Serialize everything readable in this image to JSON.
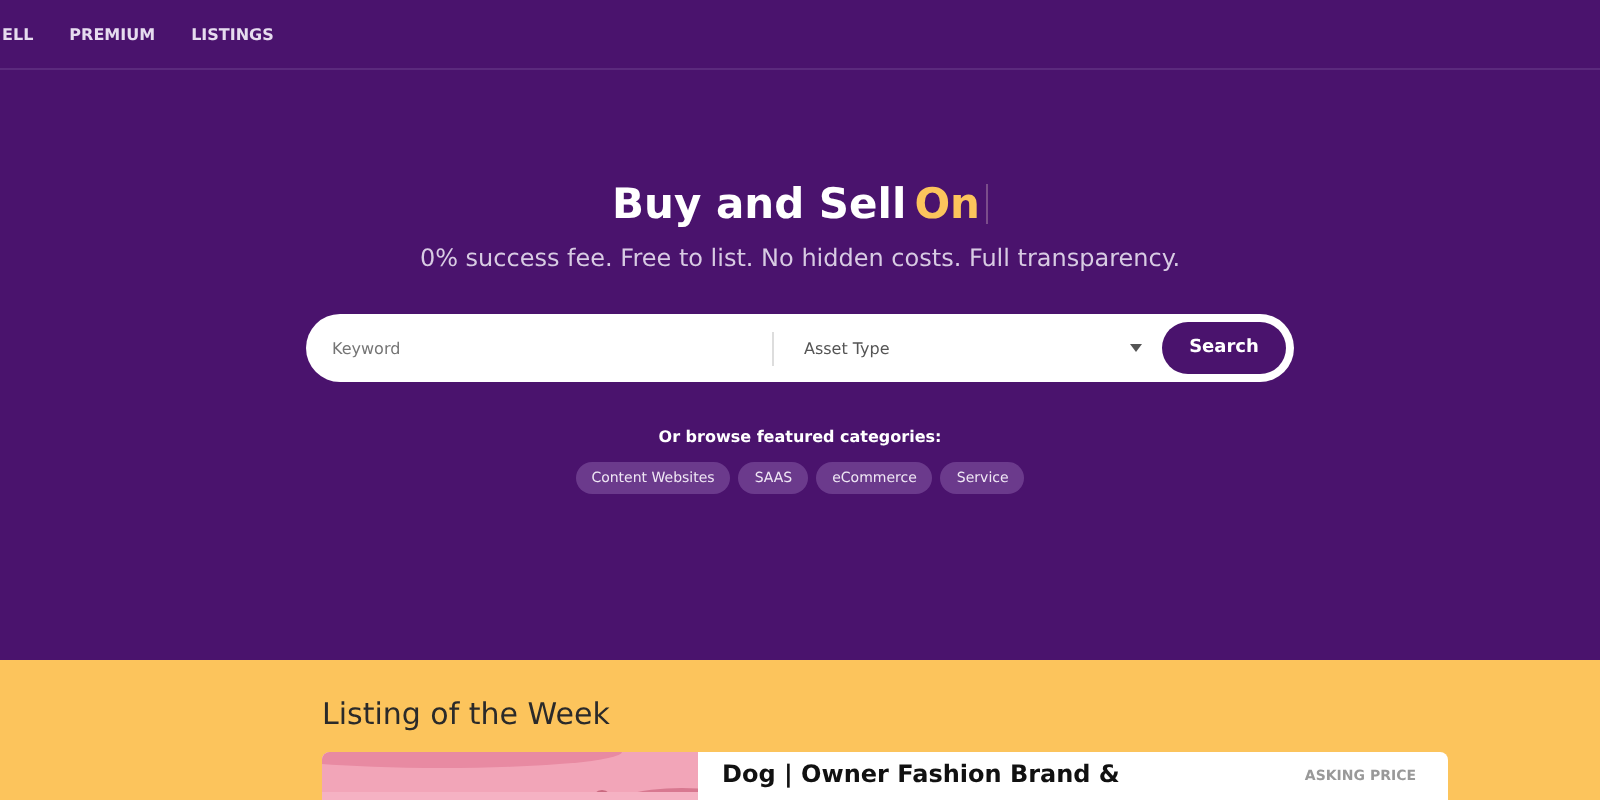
{
  "nav": {
    "items": [
      {
        "label": "ELL"
      },
      {
        "label": "PREMIUM"
      },
      {
        "label": "LISTINGS"
      }
    ]
  },
  "hero": {
    "title": "Buy and Sell",
    "title_highlight": "On",
    "subtitle": "0% success fee. Free to list. No hidden costs. Full transparency.",
    "search": {
      "keyword_placeholder": "Keyword",
      "asset_type": "Asset Type",
      "button": "Search"
    },
    "browse_label": "Or browse featured categories:",
    "categories": [
      {
        "label": "Content Websites"
      },
      {
        "label": "SAAS"
      },
      {
        "label": "eCommerce"
      },
      {
        "label": "Service"
      }
    ]
  },
  "listing": {
    "heading": "Listing of the Week",
    "title": "Dog | Owner Fashion Brand &",
    "price_label": "ASKING PRICE"
  }
}
